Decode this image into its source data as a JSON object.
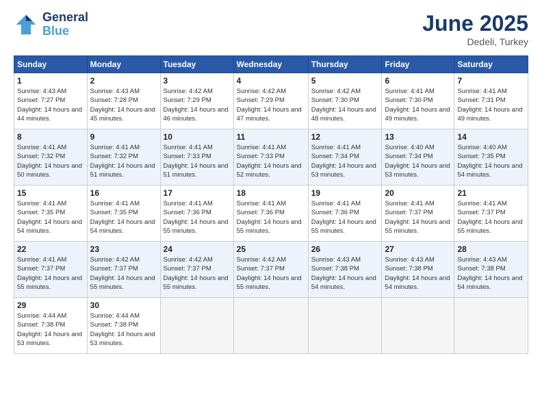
{
  "header": {
    "logo_line1": "General",
    "logo_line2": "Blue",
    "main_title": "June 2025",
    "subtitle": "Dedeli, Turkey"
  },
  "days_of_week": [
    "Sunday",
    "Monday",
    "Tuesday",
    "Wednesday",
    "Thursday",
    "Friday",
    "Saturday"
  ],
  "weeks": [
    [
      {
        "day": "1",
        "sunrise": "4:43 AM",
        "sunset": "7:27 PM",
        "daylight": "14 hours and 44 minutes."
      },
      {
        "day": "2",
        "sunrise": "4:43 AM",
        "sunset": "7:28 PM",
        "daylight": "14 hours and 45 minutes."
      },
      {
        "day": "3",
        "sunrise": "4:42 AM",
        "sunset": "7:29 PM",
        "daylight": "14 hours and 46 minutes."
      },
      {
        "day": "4",
        "sunrise": "4:42 AM",
        "sunset": "7:29 PM",
        "daylight": "14 hours and 47 minutes."
      },
      {
        "day": "5",
        "sunrise": "4:42 AM",
        "sunset": "7:30 PM",
        "daylight": "14 hours and 48 minutes."
      },
      {
        "day": "6",
        "sunrise": "4:41 AM",
        "sunset": "7:30 PM",
        "daylight": "14 hours and 49 minutes."
      },
      {
        "day": "7",
        "sunrise": "4:41 AM",
        "sunset": "7:31 PM",
        "daylight": "14 hours and 49 minutes."
      }
    ],
    [
      {
        "day": "8",
        "sunrise": "4:41 AM",
        "sunset": "7:32 PM",
        "daylight": "14 hours and 50 minutes."
      },
      {
        "day": "9",
        "sunrise": "4:41 AM",
        "sunset": "7:32 PM",
        "daylight": "14 hours and 51 minutes."
      },
      {
        "day": "10",
        "sunrise": "4:41 AM",
        "sunset": "7:33 PM",
        "daylight": "14 hours and 51 minutes."
      },
      {
        "day": "11",
        "sunrise": "4:41 AM",
        "sunset": "7:33 PM",
        "daylight": "14 hours and 52 minutes."
      },
      {
        "day": "12",
        "sunrise": "4:41 AM",
        "sunset": "7:34 PM",
        "daylight": "14 hours and 53 minutes."
      },
      {
        "day": "13",
        "sunrise": "4:40 AM",
        "sunset": "7:34 PM",
        "daylight": "14 hours and 53 minutes."
      },
      {
        "day": "14",
        "sunrise": "4:40 AM",
        "sunset": "7:35 PM",
        "daylight": "14 hours and 54 minutes."
      }
    ],
    [
      {
        "day": "15",
        "sunrise": "4:41 AM",
        "sunset": "7:35 PM",
        "daylight": "14 hours and 54 minutes."
      },
      {
        "day": "16",
        "sunrise": "4:41 AM",
        "sunset": "7:35 PM",
        "daylight": "14 hours and 54 minutes."
      },
      {
        "day": "17",
        "sunrise": "4:41 AM",
        "sunset": "7:36 PM",
        "daylight": "14 hours and 55 minutes."
      },
      {
        "day": "18",
        "sunrise": "4:41 AM",
        "sunset": "7:36 PM",
        "daylight": "14 hours and 55 minutes."
      },
      {
        "day": "19",
        "sunrise": "4:41 AM",
        "sunset": "7:36 PM",
        "daylight": "14 hours and 55 minutes."
      },
      {
        "day": "20",
        "sunrise": "4:41 AM",
        "sunset": "7:37 PM",
        "daylight": "14 hours and 55 minutes."
      },
      {
        "day": "21",
        "sunrise": "4:41 AM",
        "sunset": "7:37 PM",
        "daylight": "14 hours and 55 minutes."
      }
    ],
    [
      {
        "day": "22",
        "sunrise": "4:41 AM",
        "sunset": "7:37 PM",
        "daylight": "14 hours and 55 minutes."
      },
      {
        "day": "23",
        "sunrise": "4:42 AM",
        "sunset": "7:37 PM",
        "daylight": "14 hours and 55 minutes."
      },
      {
        "day": "24",
        "sunrise": "4:42 AM",
        "sunset": "7:37 PM",
        "daylight": "14 hours and 55 minutes."
      },
      {
        "day": "25",
        "sunrise": "4:42 AM",
        "sunset": "7:37 PM",
        "daylight": "14 hours and 55 minutes."
      },
      {
        "day": "26",
        "sunrise": "4:43 AM",
        "sunset": "7:38 PM",
        "daylight": "14 hours and 54 minutes."
      },
      {
        "day": "27",
        "sunrise": "4:43 AM",
        "sunset": "7:38 PM",
        "daylight": "14 hours and 54 minutes."
      },
      {
        "day": "28",
        "sunrise": "4:43 AM",
        "sunset": "7:38 PM",
        "daylight": "14 hours and 54 minutes."
      }
    ],
    [
      {
        "day": "29",
        "sunrise": "4:44 AM",
        "sunset": "7:38 PM",
        "daylight": "14 hours and 53 minutes."
      },
      {
        "day": "30",
        "sunrise": "4:44 AM",
        "sunset": "7:38 PM",
        "daylight": "14 hours and 53 minutes."
      },
      null,
      null,
      null,
      null,
      null
    ]
  ]
}
